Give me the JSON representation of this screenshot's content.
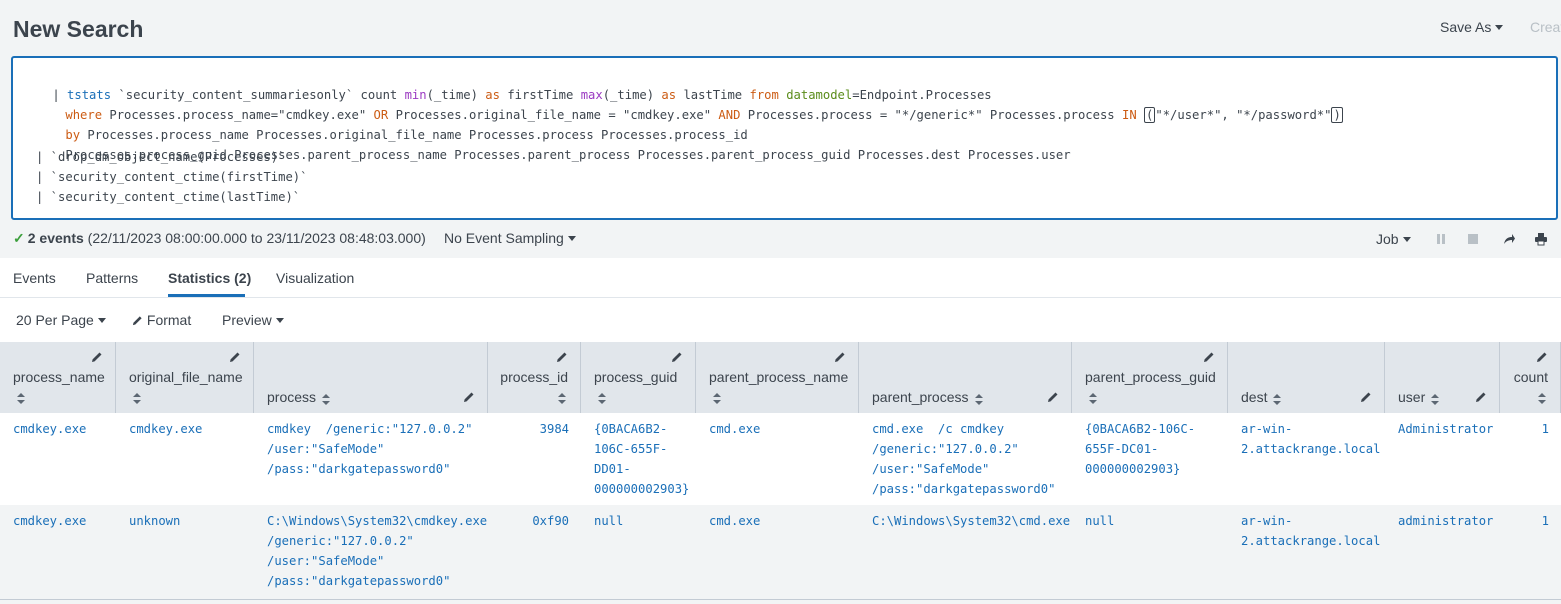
{
  "header": {
    "title": "New Search",
    "save_as": "Save As",
    "create": "Creat"
  },
  "search": {
    "lines": [
      [
        "| ",
        "tstats",
        " `security_content_summariesonly` count ",
        "min",
        "(_time) ",
        "as",
        " firstTime ",
        "max",
        "(_time) ",
        "as",
        " lastTime ",
        "from",
        " ",
        "datamodel",
        "=Endpoint.Processes"
      ],
      [
        "where",
        " Processes.process_name=\"cmdkey.exe\" ",
        "OR",
        " Processes.original_file_name = \"cmdkey.exe\" ",
        "AND",
        " Processes.process = \"*/generic*\" Processes.process ",
        "IN",
        " ",
        "(",
        "\"*/user*\", \"*/password*\"",
        ")"
      ],
      [
        "by",
        " Processes.process_name Processes.original_file_name Processes.process Processes.process_id"
      ],
      [
        "Processes.process_guid Processes.parent_process_name Processes.parent_process Processes.parent_process_guid Processes.dest Processes.user"
      ],
      [
        "| `drop_dm_object_name(Processes)`"
      ],
      [
        "| `security_content_ctime(firstTime)`"
      ],
      [
        "| `security_content_ctime(lastTime)`"
      ]
    ]
  },
  "status": {
    "events_count": "2 events",
    "range": "(22/11/2023 08:00:00.000 to 23/11/2023 08:48:03.000)",
    "sampling": "No Event Sampling",
    "job": "Job"
  },
  "tabs": [
    {
      "label": "Events"
    },
    {
      "label": "Patterns"
    },
    {
      "label": "Statistics (2)"
    },
    {
      "label": "Visualization"
    }
  ],
  "toolbar": {
    "per_page": "20 Per Page",
    "format": "Format",
    "preview": "Preview"
  },
  "table": {
    "columns": [
      "process_name",
      "original_file_name",
      "process",
      "process_id",
      "process_guid",
      "parent_process_name",
      "parent_process",
      "parent_process_guid",
      "dest",
      "user",
      "count"
    ],
    "rows": [
      [
        "cmdkey.exe",
        "cmdkey.exe",
        "cmdkey  /generic:\"127.0.0.2\"\n/user:\"SafeMode\"\n/pass:\"darkgatepassword0\"",
        "3984",
        "{0BACA6B2-\n106C-655F-\nDD01-\n000000002903}",
        "cmd.exe",
        "cmd.exe  /c cmdkey\n/generic:\"127.0.0.2\"\n/user:\"SafeMode\"\n/pass:\"darkgatepassword0\"",
        "{0BACA6B2-106C-\n655F-DC01-\n000000002903}",
        "ar-win-\n2.attackrange.local",
        "Administrator",
        "1"
      ],
      [
        "cmdkey.exe",
        "unknown",
        "C:\\Windows\\System32\\cmdkey.exe\n/generic:\"127.0.0.2\"\n/user:\"SafeMode\"\n/pass:\"darkgatepassword0\"",
        "0xf90",
        "null",
        "cmd.exe",
        "C:\\Windows\\System32\\cmd.exe",
        "null",
        "ar-win-\n2.attackrange.local",
        "administrator",
        "1"
      ]
    ]
  },
  "colors": {
    "accent": "#1a6fb8",
    "keyword_orange": "#cc5c14",
    "keyword_purple": "#9b3ac2",
    "keyword_green": "#5a8c1a",
    "success": "#3c9f3c"
  }
}
